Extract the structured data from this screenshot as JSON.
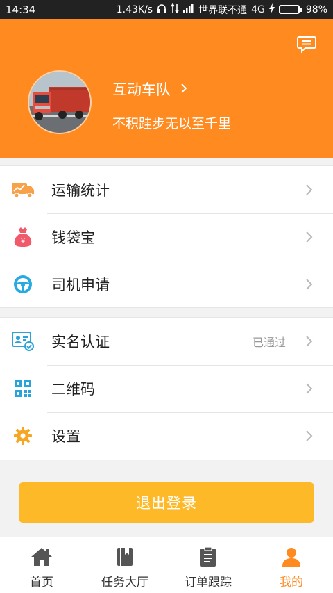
{
  "status_bar": {
    "time": "14:34",
    "speed": "1.43K/s",
    "carrier": "世界联不通",
    "network": "4G",
    "battery": "98%",
    "battery_level": 0.98
  },
  "header": {
    "team_name": "互动车队",
    "slogan": "不积跬步无以至千里",
    "bg_color": "#ff8a1f"
  },
  "menu_group1": [
    {
      "label": "运输统计",
      "icon": "truck-chart-icon"
    },
    {
      "label": "钱袋宝",
      "icon": "money-bag-icon"
    },
    {
      "label": "司机申请",
      "icon": "steering-wheel-icon"
    }
  ],
  "menu_group2": [
    {
      "label": "实名认证",
      "icon": "id-card-icon",
      "status": "已通过"
    },
    {
      "label": "二维码",
      "icon": "qr-code-icon"
    },
    {
      "label": "设置",
      "icon": "gear-icon"
    }
  ],
  "logout_label": "退出登录",
  "tabs": [
    {
      "label": "首页",
      "icon": "home-icon",
      "active": false
    },
    {
      "label": "任务大厅",
      "icon": "book-icon",
      "active": false
    },
    {
      "label": "订单跟踪",
      "icon": "clipboard-icon",
      "active": false
    },
    {
      "label": "我的",
      "icon": "person-icon",
      "active": true
    }
  ],
  "colors": {
    "accent": "#ff8a1f",
    "button": "#fdb928",
    "active_tab": "#ff8a1f"
  }
}
